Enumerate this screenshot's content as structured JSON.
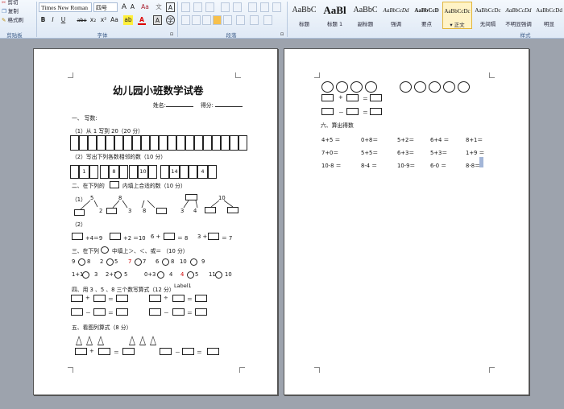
{
  "ribbon": {
    "clipboard": {
      "cut": "剪切",
      "copy": "复制",
      "format_painter": "格式刷",
      "group": "剪贴板"
    },
    "font": {
      "name": "Times New Roman",
      "size": "四号",
      "grow": "A",
      "shrink": "A",
      "clear": "Aa",
      "bold": "B",
      "italic": "I",
      "underline": "U",
      "strike": "abe",
      "sub": "x₂",
      "sup": "x²",
      "case": "Aa",
      "highlight": "ab",
      "color": "A",
      "border": "A",
      "group": "字体"
    },
    "paragraph": {
      "group": "段落"
    },
    "styles": {
      "group": "样式",
      "items": [
        {
          "preview": "AaBbC",
          "name": "标题"
        },
        {
          "preview": "AaBl",
          "name": "标题 1"
        },
        {
          "preview": "AaBbC",
          "name": "副标题"
        },
        {
          "preview": "AaBbCcDd",
          "name": "强调"
        },
        {
          "preview": "AaBbCcD",
          "name": "要点"
        },
        {
          "preview": "AaBbCcDc",
          "name": "正文",
          "selected": true
        },
        {
          "preview": "AaBbCcDc",
          "name": "无间隔"
        },
        {
          "preview": "AaBbCcDd",
          "name": "不明显强调"
        },
        {
          "preview": "AaBbCcDd",
          "name": "明显"
        }
      ]
    }
  },
  "doc": {
    "title": "幼儿园小班数学试卷",
    "name_label": "姓名:",
    "score_label": "得分:",
    "s1": "一、 写数:",
    "s1a": "（1）从 1 写到 20（20 分）",
    "s1b": "（2）写出下列各数相邻的数（10 分）",
    "neighbors": [
      "1",
      "8",
      "10",
      "14",
      "4"
    ],
    "s2": "二、在下列的",
    "s2b": "内填上合适的数（10 分）",
    "s2_1": "（1）",
    "split_tops": [
      "5",
      "8",
      "",
      "10"
    ],
    "split_parts": [
      [
        "",
        "2"
      ],
      [
        "",
        "3"
      ],
      [
        "8",
        ""
      ],
      [
        "3",
        "4"
      ],
      [
        "",
        ""
      ]
    ],
    "s2_2": "（2）",
    "eqs2": [
      "+4＝9",
      "+2 ＝10",
      "6 +",
      "＝ 8",
      "3 +",
      "＝ 7"
    ],
    "s3": "三、在下列",
    "s3b": "中填上＞、＜、或＝ （10 分）",
    "cmp1": [
      "9",
      "8",
      "2",
      "5",
      "7",
      "7",
      "6",
      "8",
      "10",
      "9"
    ],
    "cmp2": [
      "1+1",
      "3",
      "2+1",
      "5",
      "0+3",
      "4",
      "4",
      "5",
      "11",
      "10"
    ],
    "s4": "四、用 3 、5 、8 三个数写算式（12 分）",
    "label1": "Label1",
    "ops4": [
      "+",
      "＝",
      "÷",
      "＝",
      "－",
      "＝",
      "－",
      "＝"
    ],
    "s5": "五、看图列算式（8 分）",
    "ops5": [
      "+",
      "＝",
      "－",
      "＝"
    ],
    "s6": "六、算出得数",
    "ops_p2": [
      "+",
      "＝",
      "－",
      "＝"
    ],
    "calc": [
      [
        "4+5 ＝",
        "0+8＝",
        "5+2＝",
        "6+4 ＝",
        "8+1＝"
      ],
      [
        "7+0＝",
        "5+5＝",
        "6+3＝",
        "5+3＝",
        "1+9 ＝"
      ],
      [
        "10-8 ＝",
        "8-4 ＝",
        "10-9＝",
        "6-0 ＝",
        "8-8＝"
      ]
    ]
  }
}
